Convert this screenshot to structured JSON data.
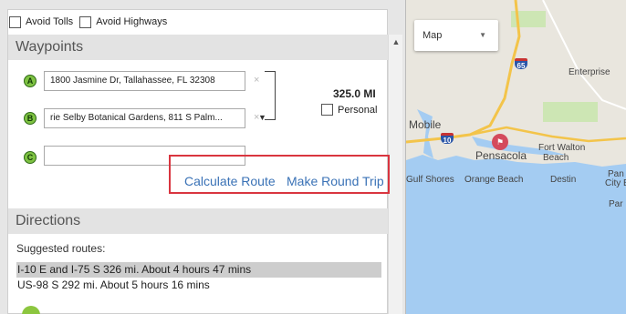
{
  "options": {
    "avoid_tolls": "Avoid Tolls",
    "avoid_highways": "Avoid Highways"
  },
  "waypoints": {
    "title": "Waypoints",
    "items": [
      {
        "marker": "A",
        "value": "1800 Jasmine Dr, Tallahassee, FL 32308"
      },
      {
        "marker": "B",
        "value": "rie Selby Botanical Gardens, 811 S Palm..."
      },
      {
        "marker": "C",
        "value": ""
      }
    ],
    "remove_glyph": "×",
    "distance": "325.0 MI",
    "personal_label": "Personal"
  },
  "actions": {
    "calculate_route": "Calculate Route",
    "round_trip": "Make Round Trip"
  },
  "directions": {
    "title": "Directions",
    "suggested_label": "Suggested routes:",
    "routes": [
      {
        "text": "I-10 E and I-75 S 326 mi. About 4 hours 47 mins",
        "selected": true
      },
      {
        "text": "US-98 S 292 mi. About 5 hours 16 mins",
        "selected": false
      }
    ]
  },
  "map": {
    "type_selected": "Map",
    "labels": {
      "enterprise": "Enterprise",
      "mobile": "Mobile",
      "pensacola": "Pensacola",
      "fort_walton": "Fort Walton",
      "beach": "Beach",
      "gulf_shores": "Gulf Shores",
      "orange_beach": "Orange Beach",
      "destin": "Destin",
      "pan": "Pan",
      "city_b": "City B",
      "par": "Par"
    },
    "shields": {
      "i65": "65",
      "i10": "10"
    },
    "colors": {
      "land": "#e9e6de",
      "water": "#a4ccf2",
      "highway": "#f3c44a",
      "park": "#cde6b4"
    }
  },
  "colors": {
    "highlight": "#d9353f",
    "link": "#3a72b6",
    "waypoint_marker": "#7ec242",
    "selected_route_bg": "#cdcdcd"
  }
}
